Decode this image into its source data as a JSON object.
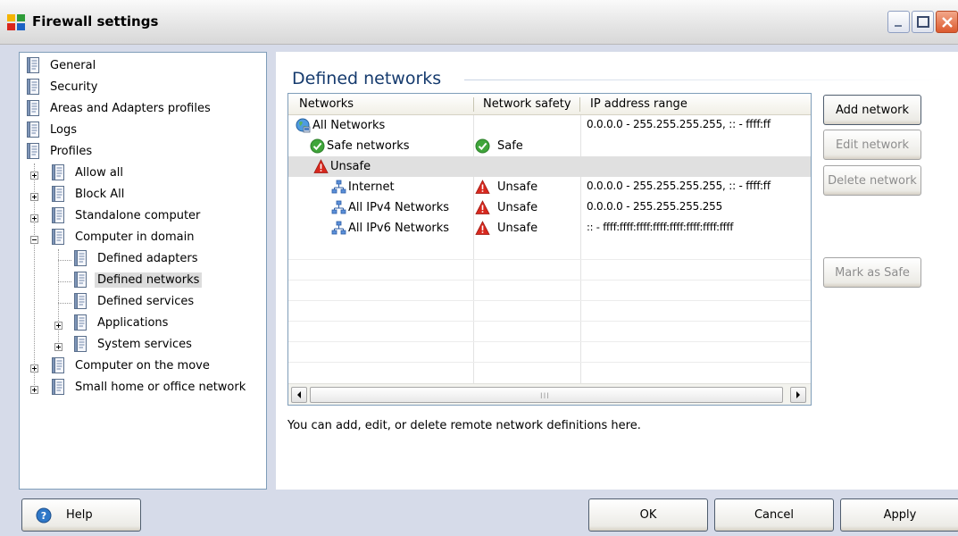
{
  "window": {
    "title": "Firewall settings",
    "icon": "avg-app-icon"
  },
  "tree": {
    "items": [
      {
        "label": "General",
        "level": 0,
        "expander": "none"
      },
      {
        "label": "Security",
        "level": 0,
        "expander": "none"
      },
      {
        "label": "Areas and Adapters profiles",
        "level": 0,
        "expander": "none"
      },
      {
        "label": "Logs",
        "level": 0,
        "expander": "none"
      },
      {
        "label": "Profiles",
        "level": 0,
        "expander": "none"
      },
      {
        "label": "Allow all",
        "level": 1,
        "expander": "plus"
      },
      {
        "label": "Block All",
        "level": 1,
        "expander": "plus"
      },
      {
        "label": "Standalone computer",
        "level": 1,
        "expander": "plus"
      },
      {
        "label": "Computer in domain",
        "level": 1,
        "expander": "minus"
      },
      {
        "label": "Defined adapters",
        "level": 2,
        "expander": "none"
      },
      {
        "label": "Defined networks",
        "level": 2,
        "expander": "none",
        "selected": true
      },
      {
        "label": "Defined services",
        "level": 2,
        "expander": "none"
      },
      {
        "label": "Applications",
        "level": 2,
        "expander": "plus"
      },
      {
        "label": "System services",
        "level": 2,
        "expander": "plus"
      },
      {
        "label": "Computer on the move",
        "level": 1,
        "expander": "plus"
      },
      {
        "label": "Small home or office network",
        "level": 1,
        "expander": "plus"
      }
    ]
  },
  "main": {
    "title": "Defined networks",
    "columns": [
      "Networks",
      "Network safety",
      "IP address range"
    ],
    "rows": [
      {
        "name": "All Networks",
        "icon": "globe-network-icon",
        "safety": "",
        "safety_icon": "",
        "ip": "0.0.0.0 - 255.255.255.255, :: - ffff:ff"
      },
      {
        "name": "Safe networks",
        "icon": "safe-check-icon",
        "safety": "Safe",
        "safety_icon": "safe-check-icon",
        "ip": ""
      },
      {
        "name": "Unsafe",
        "icon": "warning-icon",
        "safety": "",
        "safety_icon": "",
        "ip": "",
        "selected": true
      },
      {
        "name": "Internet",
        "icon": "network-icon",
        "safety": "Unsafe",
        "safety_icon": "warning-icon",
        "ip": "0.0.0.0 - 255.255.255.255, :: - ffff:ff"
      },
      {
        "name": "All IPv4 Networks",
        "icon": "network-icon",
        "safety": "Unsafe",
        "safety_icon": "warning-icon",
        "ip": "0.0.0.0 - 255.255.255.255"
      },
      {
        "name": "All IPv6 Networks",
        "icon": "network-icon",
        "safety": "Unsafe",
        "safety_icon": "warning-icon",
        "ip": ":: - ffff:ffff:ffff:ffff:ffff:ffff:ffff:ffff"
      }
    ],
    "scroll_grip": "III",
    "hint": "You can add, edit, or delete remote network definitions here."
  },
  "side_buttons": {
    "add": "Add network",
    "edit": "Edit network",
    "delete": "Delete network",
    "mark_safe": "Mark as Safe"
  },
  "footer": {
    "help": "Help",
    "ok": "OK",
    "cancel": "Cancel",
    "apply": "Apply"
  },
  "colors": {
    "title_text": "#163b6e",
    "background": "#d6dbe9",
    "selection": "#e0e0e0",
    "warning_red": "#d8281e",
    "safe_green": "#3fa53a"
  }
}
